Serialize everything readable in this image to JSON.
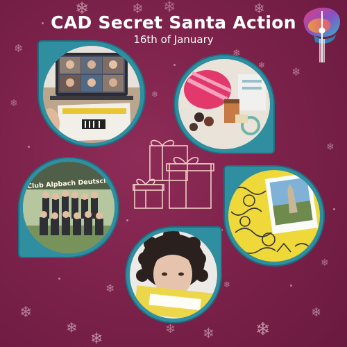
{
  "poster": {
    "title": "CAD Secret Santa Action",
    "subtitle": "16th of January"
  },
  "photos": {
    "video_call": "video-call-photo",
    "gifts": "gifts-photo",
    "group": "group-photo",
    "postcard": "postcard-photo",
    "portrait": "portrait-photo"
  },
  "group_banner": "Club Alpbach Deutschland",
  "icons": {
    "logo": "tv-tower-icon",
    "center": "gift-boxes-icon",
    "decoration": "snowflake-icon"
  },
  "colors": {
    "background": "#7a2149",
    "frame": "#2f8fa0",
    "text": "#ffffff",
    "gift_outline": "#f1cdc4"
  }
}
